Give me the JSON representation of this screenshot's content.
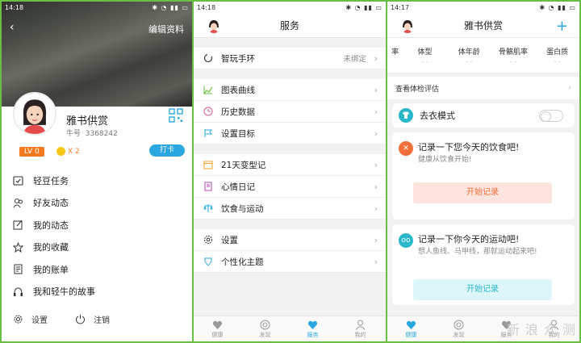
{
  "profile": {
    "status_time": "14:18",
    "edit_label": "编辑资料",
    "name": "雅书供赏",
    "id_label": "牛号",
    "id_value": "3368242",
    "level": "LV 0",
    "coins": "X 2",
    "checkin_label": "打卡",
    "menu": [
      {
        "icon": "task-icon",
        "label": "轻豆任务"
      },
      {
        "icon": "friends-icon",
        "label": "好友动态"
      },
      {
        "icon": "edit-icon",
        "label": "我的动态"
      },
      {
        "icon": "star-icon",
        "label": "我的收藏"
      },
      {
        "icon": "bill-icon",
        "label": "我的账单"
      },
      {
        "icon": "headphone-icon",
        "label": "我和轻牛的故事"
      }
    ],
    "settings_label": "设置",
    "logout_label": "注销"
  },
  "services": {
    "status_time": "14:18",
    "title": "服务",
    "sections": [
      [
        {
          "icon": "band-icon",
          "label": "智玩手环",
          "value": "未绑定"
        }
      ],
      [
        {
          "icon": "chart-icon",
          "label": "图表曲线"
        },
        {
          "icon": "history-icon",
          "label": "历史数据"
        },
        {
          "icon": "flag-icon",
          "label": "设置目标"
        }
      ],
      [
        {
          "icon": "calendar-icon",
          "label": "21天变型记"
        },
        {
          "icon": "diary-icon",
          "label": "心情日记"
        },
        {
          "icon": "scale-icon",
          "label": "饮食与运动"
        }
      ],
      [
        {
          "icon": "gear-icon",
          "label": "设置"
        },
        {
          "icon": "theme-icon",
          "label": "个性化主题"
        }
      ]
    ],
    "tabs": [
      {
        "label": "健康",
        "active": false
      },
      {
        "label": "发现",
        "active": false
      },
      {
        "label": "服务",
        "active": true
      },
      {
        "label": "我的",
        "active": false
      }
    ]
  },
  "health": {
    "status_time": "14:17",
    "title": "雅书供赏",
    "metrics": [
      {
        "label": "率",
        "value": ""
      },
      {
        "label": "体型",
        "value": "- -"
      },
      {
        "label": "体年龄",
        "value": "- -"
      },
      {
        "label": "骨骼肌率",
        "value": "- -"
      },
      {
        "label": "蛋白质",
        "value": "- -"
      }
    ],
    "eval_label": "查看体检评估",
    "dress_label": "去衣模式",
    "diet_title": "记录一下您今天的饮食吧!",
    "diet_sub": "健康从饮食开始!",
    "diet_btn": "开始记录",
    "sport_title": "记录一下你今天的运动吧!",
    "sport_sub": "想人鱼线、马甲线，那就运动起来吧!",
    "sport_btn": "开始记录",
    "tabs": [
      {
        "label": "健康",
        "active": true
      },
      {
        "label": "发现",
        "active": false
      },
      {
        "label": "服务",
        "active": false
      },
      {
        "label": "我的",
        "active": false
      }
    ],
    "watermark": "新 浪 众 测"
  },
  "colors": {
    "accent": "#2aa7e0",
    "level": "#f47920",
    "diet": "#f36f3a",
    "sport": "#2ab7c9",
    "border": "#6abe44"
  }
}
